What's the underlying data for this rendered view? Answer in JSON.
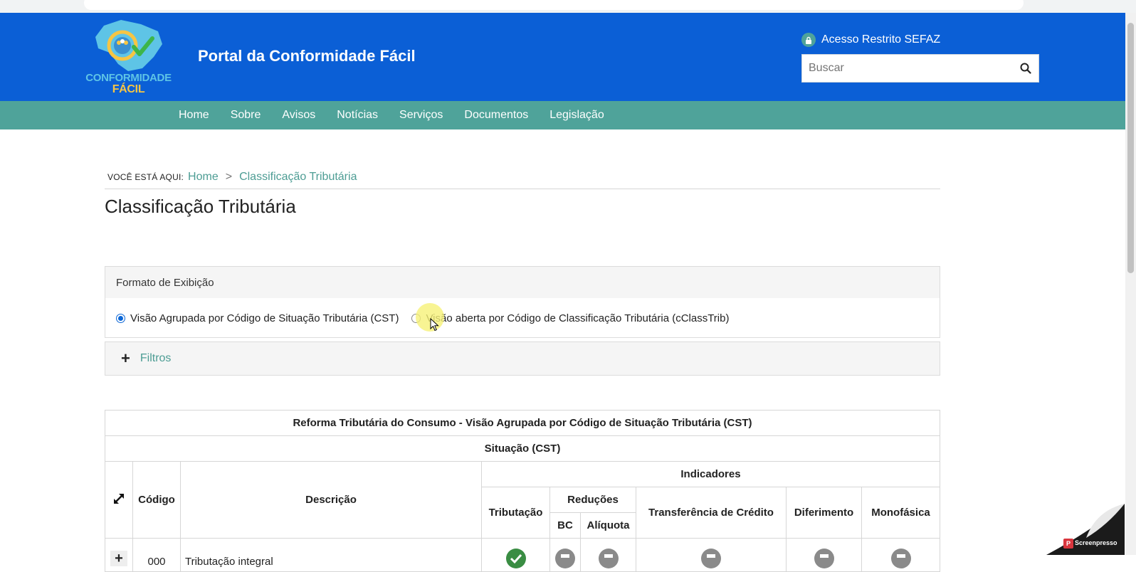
{
  "header": {
    "logo_line1": "CONFORMIDADE",
    "logo_line2": "FÁCIL",
    "portal_title": "Portal da Conformidade Fácil",
    "restricted_access": "Acesso Restrito SEFAZ",
    "search_placeholder": "Buscar"
  },
  "nav": {
    "items": [
      {
        "label": "Home"
      },
      {
        "label": "Sobre"
      },
      {
        "label": "Avisos"
      },
      {
        "label": "Notícias"
      },
      {
        "label": "Serviços"
      },
      {
        "label": "Documentos"
      },
      {
        "label": "Legislação"
      }
    ]
  },
  "breadcrumb": {
    "prefix": "VOCÊ ESTÁ AQUI:",
    "home": "Home",
    "separator": ">",
    "current": "Classificação Tributária"
  },
  "page": {
    "title": "Classificação Tributária"
  },
  "format": {
    "heading": "Formato de Exibição",
    "option_grouped": "Visão Agrupada por Código de Situação Tributária (CST)",
    "option_open": "Visão aberta por Código de Classificação Tributária (cClassTrib)",
    "selected": "grouped"
  },
  "filters": {
    "label": "Filtros"
  },
  "table": {
    "title": "Reforma Tributária do Consumo - Visão Agrupada por Código de Situação Tributária (CST)",
    "situacao": "Situação (CST)",
    "col_codigo": "Código",
    "col_descricao": "Descrição",
    "col_indicadores": "Indicadores",
    "col_tributacao": "Tributação",
    "col_reducoes": "Reduções",
    "col_bc": "BC",
    "col_aliquota": "Alíquota",
    "col_transferencia": "Transferência de Crédito",
    "col_diferimento": "Diferimento",
    "col_monofasica": "Monofásica",
    "rows": [
      {
        "codigo": "000",
        "descricao": "Tributação integral"
      }
    ]
  },
  "watermark": {
    "text": "Screenpresso"
  },
  "colors": {
    "header_blue": "#0b5fd6",
    "nav_teal": "#4fa39a",
    "link_teal": "#4d9d94",
    "check_green": "#3a8d43",
    "indicator_gray": "#8a8a8a"
  }
}
